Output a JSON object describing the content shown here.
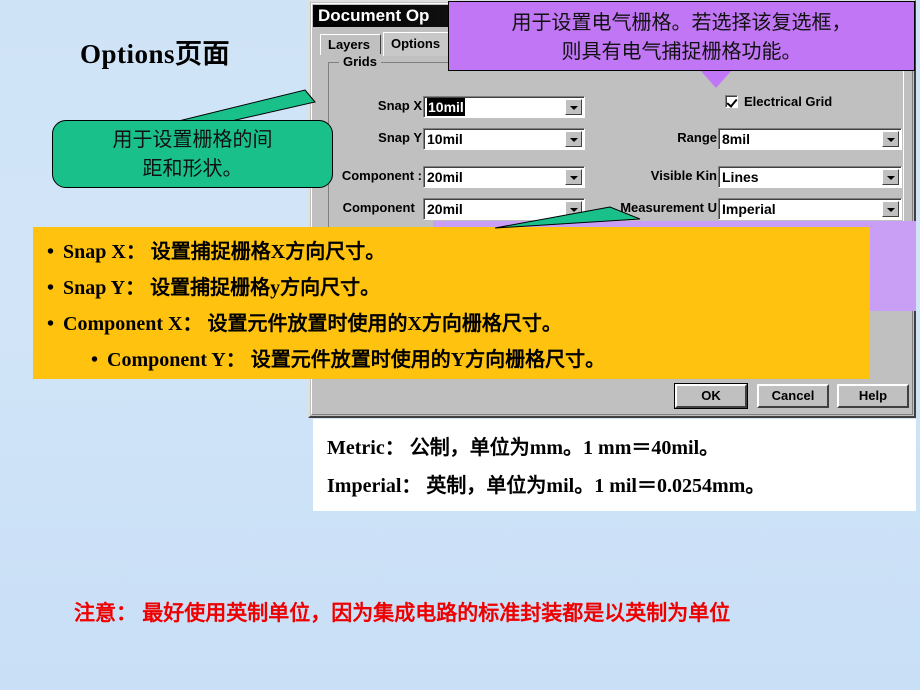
{
  "slide": {
    "title": "Options页面"
  },
  "dialog": {
    "title": "Document Op",
    "tabs": [
      {
        "label": "Layers",
        "active": false
      },
      {
        "label": "Options",
        "active": true
      }
    ],
    "group_legend": "Grids",
    "left_fields": [
      {
        "label": "Snap X",
        "value": "10mil",
        "selected": true
      },
      {
        "label": "Snap Y",
        "value": "10mil",
        "selected": false
      },
      {
        "label": "Component :",
        "value": "20mil",
        "selected": false
      },
      {
        "label": "Component  ",
        "value": "20mil",
        "selected": false
      }
    ],
    "electrical_grid": {
      "label": "Electrical Grid",
      "checked": true
    },
    "right_fields": [
      {
        "label": "Range",
        "value": "8mil"
      },
      {
        "label": "Visible Kin",
        "value": "Lines"
      },
      {
        "label": "Measurement U",
        "value": "Imperial"
      }
    ],
    "buttons": [
      {
        "label": "OK",
        "default": true
      },
      {
        "label": "Cancel",
        "default": false
      },
      {
        "label": "Help",
        "default": false
      }
    ]
  },
  "callouts": {
    "purple": {
      "line1": "用于设置电气栅格。若选择该复选框，",
      "line2": "则具有电气捕捉栅格功能。",
      "color": "#c176f5"
    },
    "green": {
      "line1": "用于设置栅格的间",
      "line2": "距和形状。",
      "color": "#19c08a"
    },
    "yellow": {
      "color": "#ffc20e",
      "bullets": [
        {
          "bullet": "•",
          "text": "Snap X： 设置捕捉栅格X方向尺寸。",
          "indent": false
        },
        {
          "bullet": "•",
          "text": "Snap Y： 设置捕捉栅格y方向尺寸。",
          "indent": false
        },
        {
          "bullet": "•",
          "text": "Component X： 设置元件放置时使用的X方向栅格尺寸。",
          "indent": false
        },
        {
          "bullet": "•",
          "text": "Component Y： 设置元件放置时使用的Y方向栅格尺寸。",
          "indent": true
        }
      ]
    }
  },
  "info_box": {
    "metric": "Metric： 公制，单位为mm。1 mm＝40mil。",
    "imperial": "Imperial： 英制，单位为mil。1 mil＝0.0254mm。"
  },
  "bottom_note": {
    "text": "注意： 最好使用英制单位，因为集成电路的标准封装都是以英制为单位",
    "color": "#ee0000"
  }
}
